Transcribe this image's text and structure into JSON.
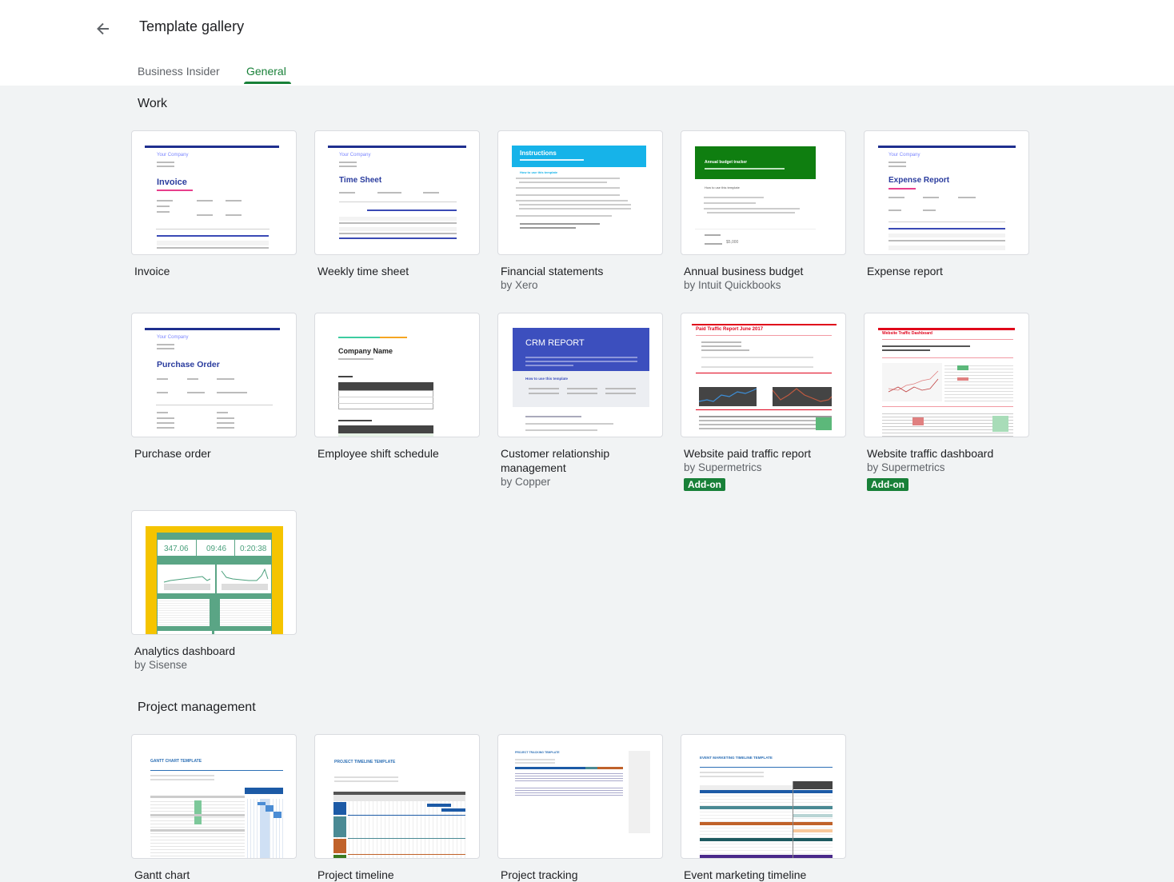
{
  "header": {
    "back_icon": "arrow-left-icon",
    "title": "Template gallery",
    "tabs": [
      {
        "label": "Business Insider",
        "active": false
      },
      {
        "label": "General",
        "active": true
      }
    ]
  },
  "colors": {
    "accent": "#188038",
    "background": "#f1f3f4",
    "badge": "#188038"
  },
  "sections": [
    {
      "title": "Work",
      "templates": [
        {
          "name": "Invoice",
          "by": null,
          "thumb": {
            "company": "Your Company",
            "heading": "Invoice"
          }
        },
        {
          "name": "Weekly time sheet",
          "by": null,
          "thumb": {
            "company": "Your Company",
            "heading": "Time Sheet"
          }
        },
        {
          "name": "Financial statements",
          "by": "by Xero",
          "thumb": {
            "heading": "Instructions",
            "subheading": "How to use this template"
          }
        },
        {
          "name": "Annual business budget",
          "by": "by Intuit Quickbooks",
          "thumb": {
            "heading": "Annual budget tracker",
            "subheading": "How to use this template",
            "value": "$5,000"
          }
        },
        {
          "name": "Expense report",
          "by": null,
          "thumb": {
            "company": "Your Company",
            "heading": "Expense Report"
          }
        },
        {
          "name": "Purchase order",
          "by": null,
          "thumb": {
            "company": "Your Company",
            "heading": "Purchase Order"
          }
        },
        {
          "name": "Employee shift schedule",
          "by": null,
          "thumb": {
            "heading": "Company Name"
          }
        },
        {
          "name": "Customer relationship management",
          "by": "by Copper",
          "thumb": {
            "heading": "CRM REPORT",
            "subheading": "How to use this template"
          }
        },
        {
          "name": "Website paid traffic report",
          "by": "by Supermetrics",
          "badge": "Add-on",
          "thumb": {
            "heading": "Paid Traffic Report June 2017"
          }
        },
        {
          "name": "Website traffic dashboard",
          "by": "by Supermetrics",
          "badge": "Add-on",
          "thumb": {
            "heading": "Website Traffic Dashboard"
          }
        },
        {
          "name": "Analytics dashboard",
          "by": "by Sisense",
          "thumb": {
            "kpi1": "347.06",
            "kpi2": "09:46",
            "kpi3": "0:20:38"
          }
        }
      ]
    },
    {
      "title": "Project management",
      "templates": [
        {
          "name": "Gantt chart",
          "thumb": {
            "heading": "GANTT CHART TEMPLATE"
          }
        },
        {
          "name": "Project timeline",
          "thumb": {
            "heading": "PROJECT TIMELINE TEMPLATE"
          }
        },
        {
          "name": "Project tracking",
          "thumb": {
            "heading": "PROJECT TRACKING TEMPLATE"
          }
        },
        {
          "name": "Event marketing timeline",
          "thumb": {
            "heading": "EVENT MARKETING TIMELINE TEMPLATE"
          }
        }
      ]
    }
  ]
}
